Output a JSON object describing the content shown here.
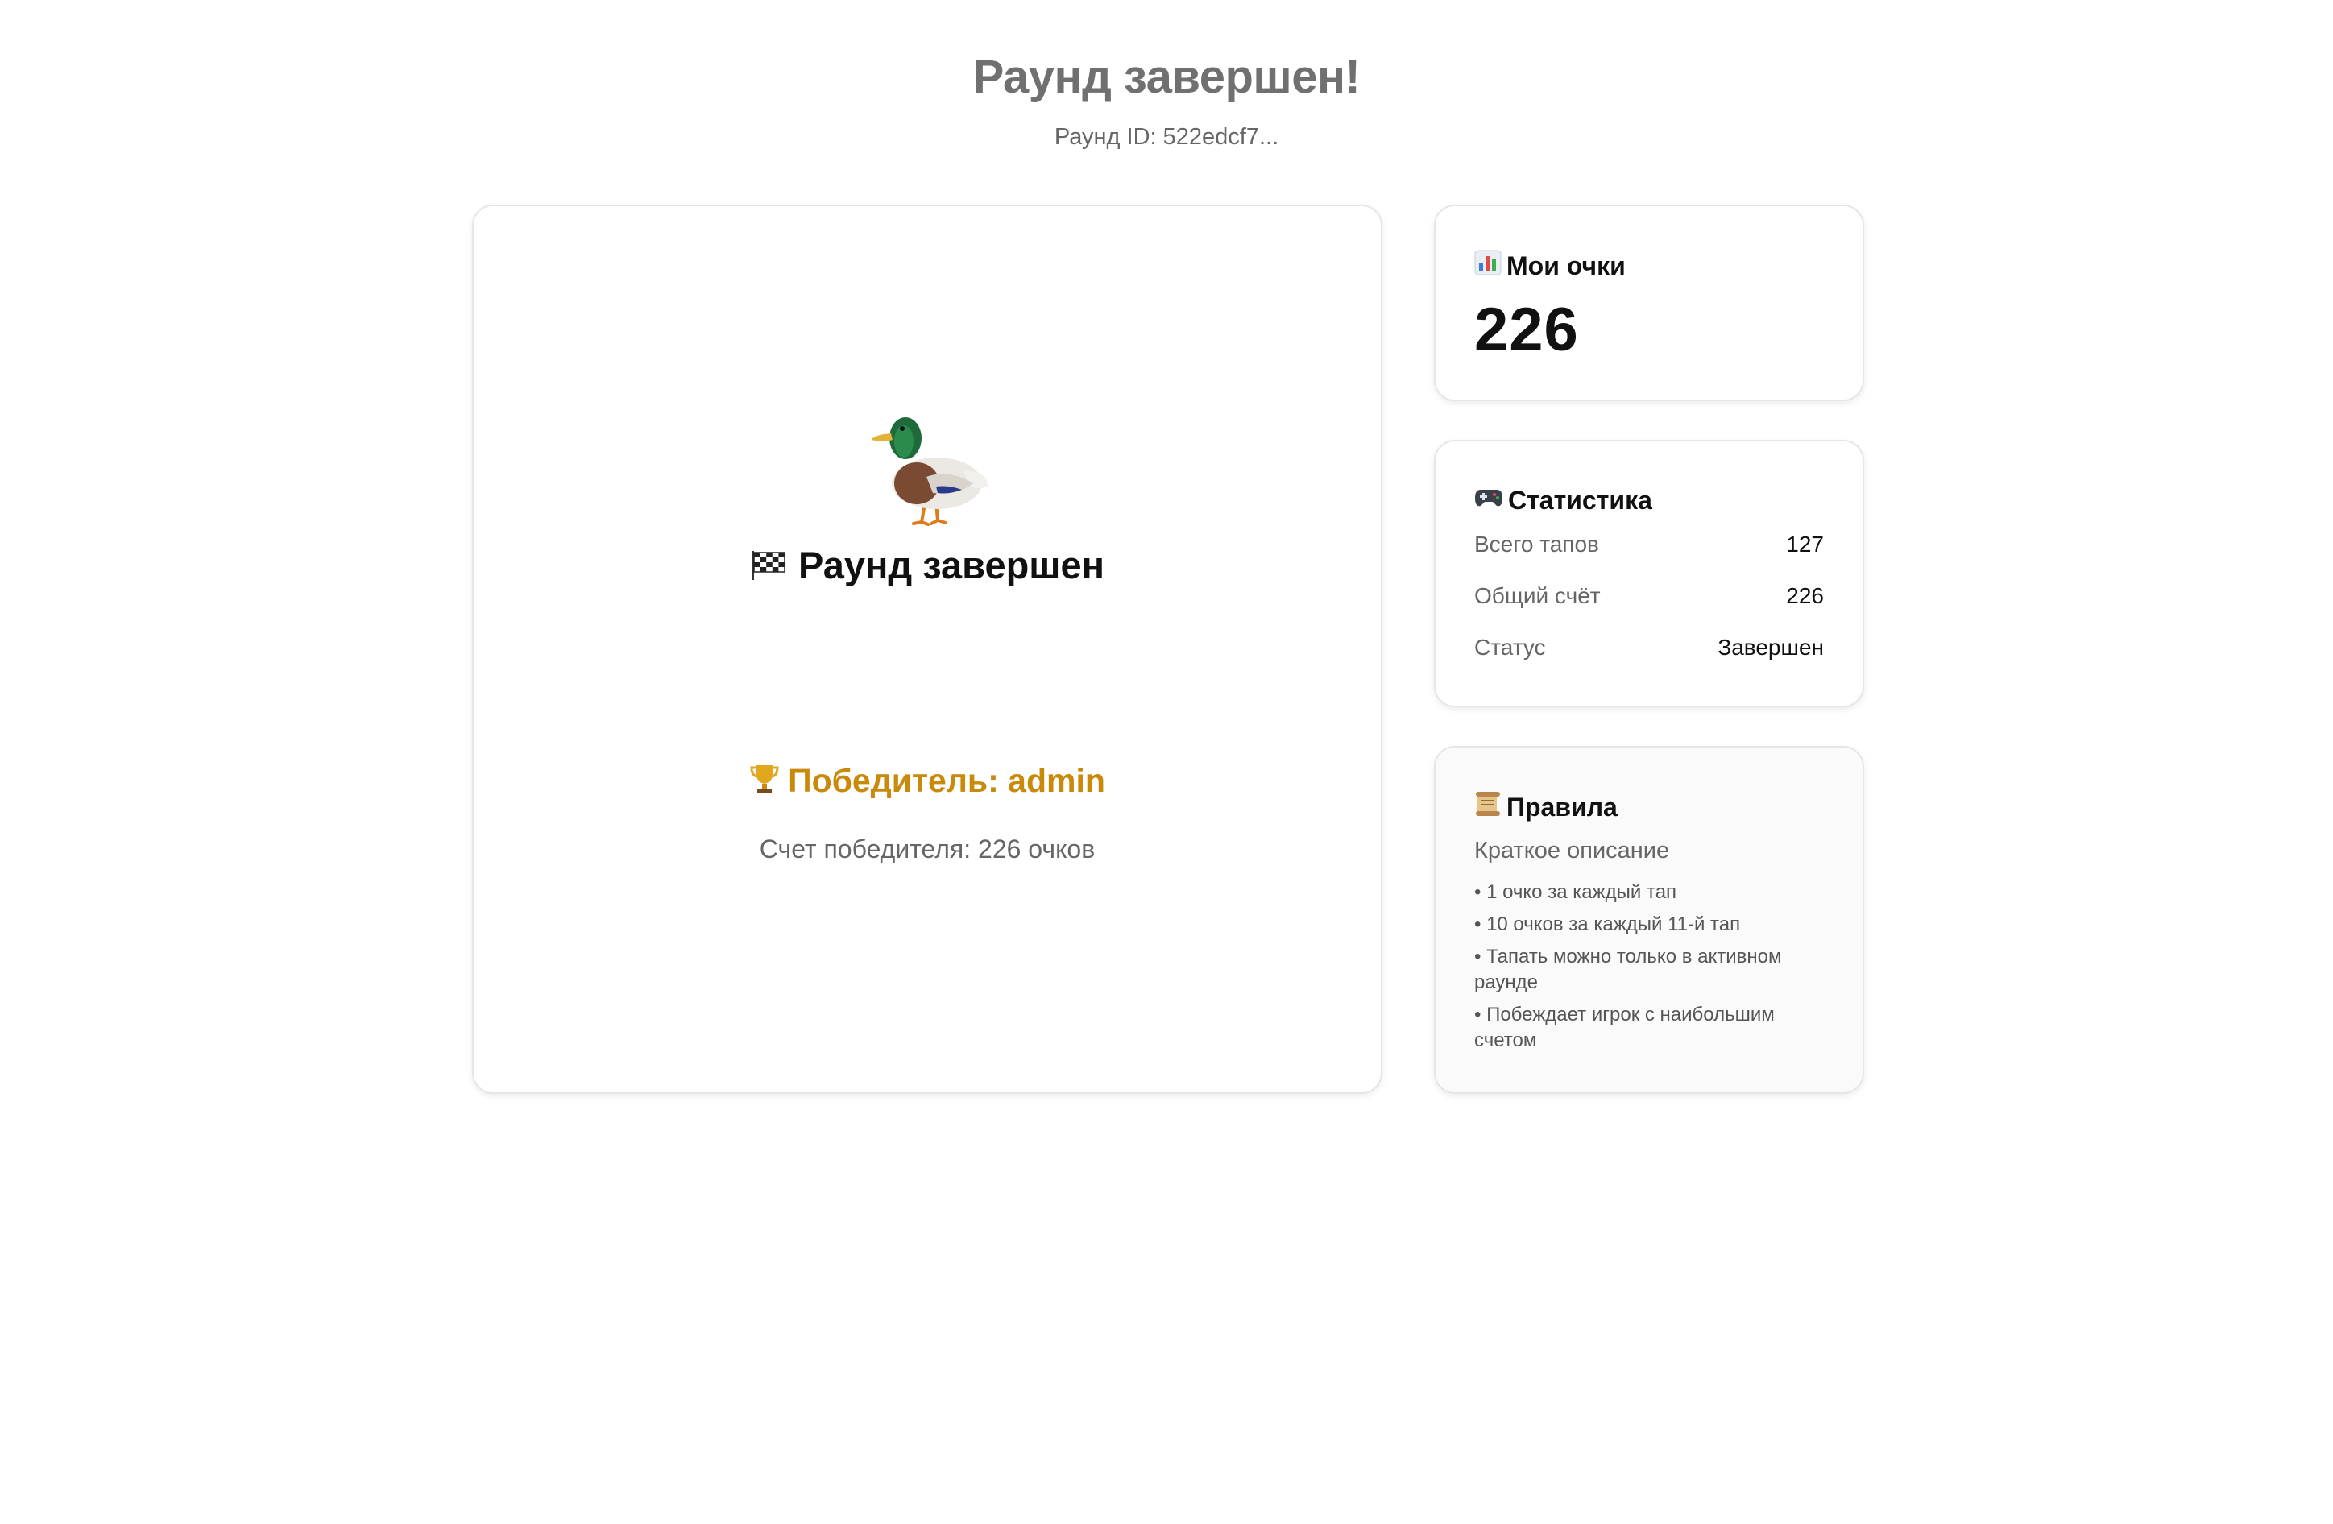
{
  "header": {
    "title": "Раунд завершен!",
    "round_id": "Раунд ID: 522edcf7..."
  },
  "main": {
    "status_title": "Раунд завершен",
    "flag_icon": "checkered-flag-icon",
    "mascot_icon": "duck-icon",
    "trophy_icon": "trophy-icon",
    "winner_label": "Победитель: admin",
    "winner_score": "Счет победителя: 226 очков",
    "winner_color": "#c98a0c"
  },
  "my_score": {
    "icon": "bar-chart-icon",
    "title": "Мои очки",
    "value": "226"
  },
  "stats": {
    "icon": "gamepad-icon",
    "title": "Статистика",
    "rows": [
      {
        "label": "Всего тапов",
        "value": "127"
      },
      {
        "label": "Общий счёт",
        "value": "226"
      },
      {
        "label": "Статус",
        "value": "Завершен"
      }
    ]
  },
  "rules": {
    "icon": "scroll-icon",
    "title": "Правила",
    "subtitle": "Краткое описание",
    "items": [
      "• 1 очко за каждый тап",
      "• 10 очков за каждый 11-й тап",
      "• Тапать можно только в активном раунде",
      "• Побеждает игрок с наибольшим счетом"
    ]
  }
}
